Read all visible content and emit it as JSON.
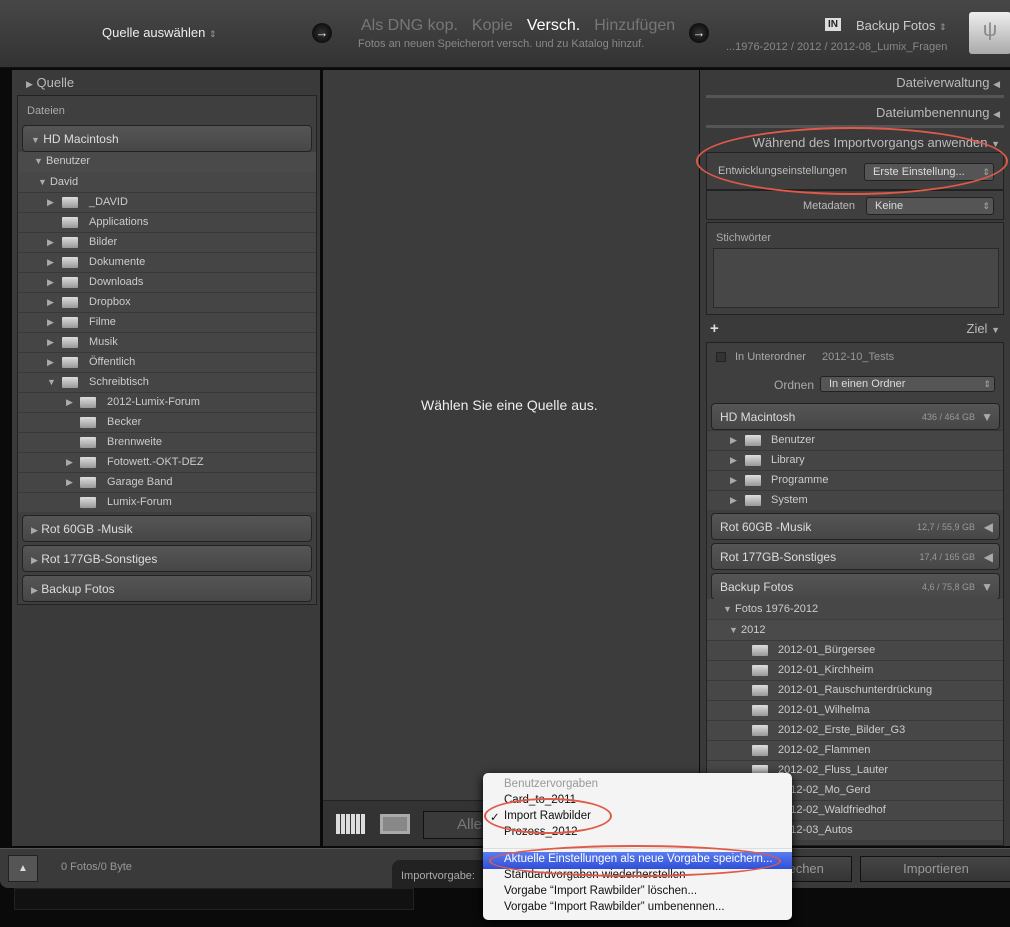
{
  "top": {
    "source_select": "Quelle auswählen",
    "modes": [
      "Als DNG kop.",
      "Kopie",
      "Versch.",
      "Hinzufügen"
    ],
    "active_mode": "Versch.",
    "mode_description": "Fotos an neuen Speicherort versch. und zu Katalog hinzuf.",
    "in_badge": "IN",
    "dest_name": "Backup Fotos",
    "dest_path": "...1976-2012 / 2012 / 2012-08_Lumix_Fragen"
  },
  "left": {
    "header": "Quelle",
    "section": "Dateien",
    "drive": "HD Macintosh",
    "user_folder": "Benutzer",
    "david": "David",
    "folders": [
      {
        "name": "_DAVID",
        "arrow": true
      },
      {
        "name": "Applications",
        "arrow": false
      },
      {
        "name": "Bilder",
        "arrow": true
      },
      {
        "name": "Dokumente",
        "arrow": true
      },
      {
        "name": "Downloads",
        "arrow": true
      },
      {
        "name": "Dropbox",
        "arrow": true
      },
      {
        "name": "Filme",
        "arrow": true
      },
      {
        "name": "Musik",
        "arrow": true
      },
      {
        "name": "Öffentlich",
        "arrow": true
      },
      {
        "name": "Schreibtisch",
        "arrow": "open"
      }
    ],
    "desk": [
      {
        "name": "2012-Lumix-Forum",
        "arrow": true
      },
      {
        "name": "Becker",
        "arrow": false
      },
      {
        "name": "Brennweite",
        "arrow": false
      },
      {
        "name": "Fotowett.-OKT-DEZ",
        "arrow": true
      },
      {
        "name": "Garage Band",
        "arrow": true
      },
      {
        "name": "Lumix-Forum",
        "arrow": false
      }
    ],
    "drives": [
      "Rot 60GB -Musik",
      "Rot 177GB-Sonstiges",
      "Backup Fotos"
    ]
  },
  "center": {
    "message": "Wählen Sie eine Quelle aus.",
    "sort_button": "Alle"
  },
  "right": {
    "file_handling": "Dateiverwaltung",
    "file_renaming": "Dateiumbenennung",
    "apply_during_import": "Während des Importvorgangs anwenden",
    "develop_label": "Entwicklungseinstellungen",
    "develop_value": "Erste Einstellung...",
    "metadata_label": "Metadaten",
    "metadata_value": "Keine",
    "keywords_label": "Stichwörter",
    "dest_header": "Ziel",
    "subfolder_label": "In Unterordner",
    "subfolder_value": "2012-10_Tests",
    "organize_label": "Ordnen",
    "organize_value": "In einen Ordner",
    "hd": {
      "name": "HD Macintosh",
      "size": "436 / 464 GB"
    },
    "hd_folders": [
      "Benutzer",
      "Library",
      "Programme",
      "System"
    ],
    "drives": [
      {
        "name": "Rot 60GB -Musik",
        "size": "12,7 / 55,9 GB"
      },
      {
        "name": "Rot 177GB-Sonstiges",
        "size": "17,4 / 165 GB"
      },
      {
        "name": "Backup Fotos",
        "size": "4,6 / 75,8 GB"
      }
    ],
    "fotos": "Fotos 1976-2012",
    "year": "2012",
    "year_folders": [
      "2012-01_Bürgersee",
      "2012-01_Kirchheim",
      "2012-01_Rauschunterdrückung",
      "2012-01_Wilhelma",
      "2012-02_Erste_Bilder_G3",
      "2012-02_Flammen",
      "2012-02_Fluss_Lauter",
      "2012-02_Mo_Gerd",
      "2012-02_Waldfriedhof",
      "2012-03_Autos"
    ]
  },
  "bottom": {
    "count": "0 Fotos/0 Byte",
    "preset_label": "Importvorgabe:",
    "cancel": "Abbrechen",
    "import": "Importieren"
  },
  "menu": {
    "heading": "Benutzervorgaben",
    "presets": [
      "Card_to_2011",
      "Import Rawbilder",
      "Prozess_2012"
    ],
    "checked": "Import Rawbilder",
    "actions": [
      "Aktuelle Einstellungen als neue Vorgabe speichern...",
      "Standardvorgaben wiederherstellen",
      "Vorgabe “Import Rawbilder” löschen...",
      "Vorgabe “Import Rawbilder” umbenennen..."
    ]
  },
  "colors": {
    "highlight": "#3d5fe0",
    "annotation": "#e05a4a"
  }
}
